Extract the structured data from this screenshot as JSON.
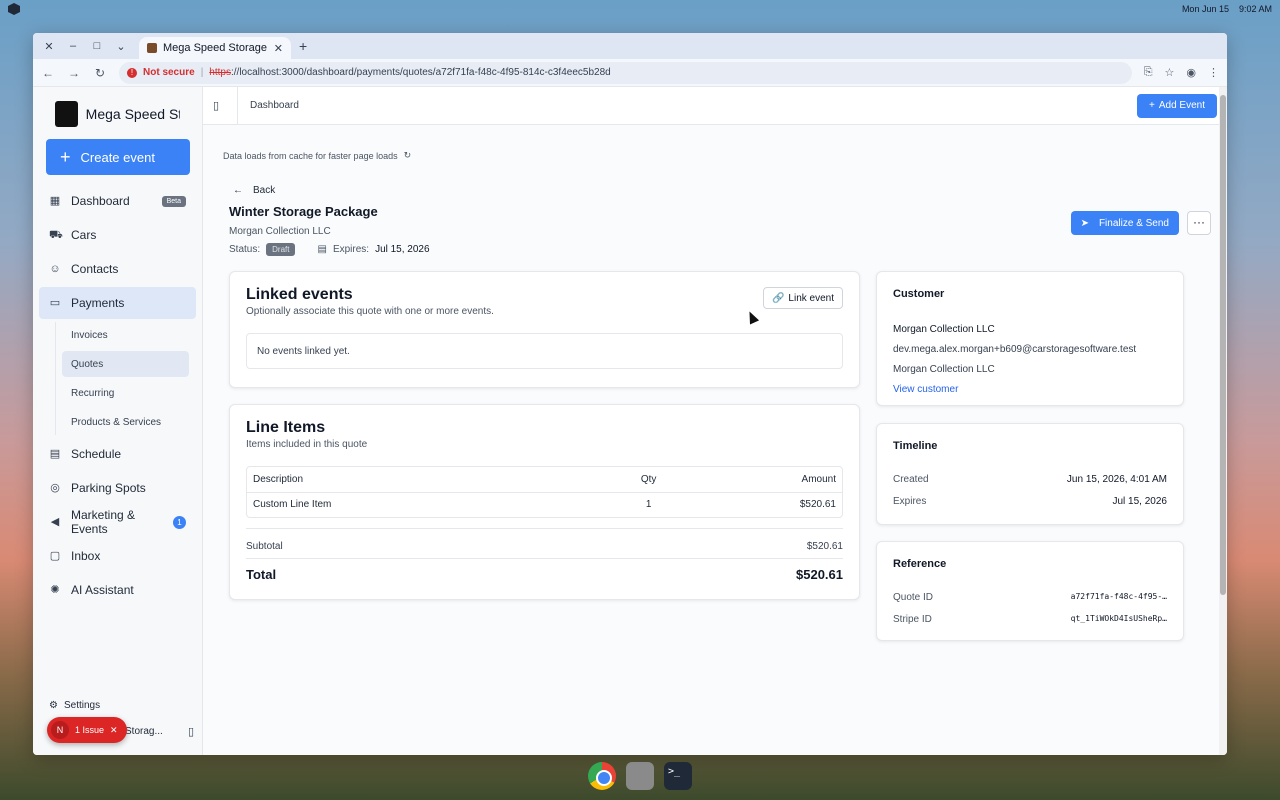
{
  "os": {
    "date": "Mon Jun 15",
    "time": "9:02 AM"
  },
  "browser": {
    "tab_title": "Mega Speed Storage",
    "not_secure": "Not secure",
    "url_scheme": "https",
    "url_rest": "://localhost:3000/dashboard/payments/quotes/a72f71fa-f48c-4f95-814c-c3f4eec5b28d"
  },
  "sidebar": {
    "brand": "Mega Speed St...",
    "create_event": "Create event",
    "items": [
      {
        "label": "Dashboard",
        "icon": "grid-icon",
        "badge": "Beta"
      },
      {
        "label": "Cars",
        "icon": "car-icon"
      },
      {
        "label": "Contacts",
        "icon": "users-icon"
      },
      {
        "label": "Payments",
        "icon": "credit-card-icon"
      },
      {
        "label": "Schedule",
        "icon": "calendar-icon"
      },
      {
        "label": "Parking Spots",
        "icon": "map-pin-icon"
      },
      {
        "label": "Marketing & Events",
        "icon": "megaphone-icon",
        "count": "1"
      },
      {
        "label": "Inbox",
        "icon": "message-icon"
      },
      {
        "label": "AI Assistant",
        "icon": "ai-icon"
      }
    ],
    "sub_items": [
      "Invoices",
      "Quotes",
      "Recurring",
      "Products & Services"
    ],
    "settings": "Settings",
    "workspace": "Storag...",
    "issue_avatar": "N",
    "issue": "1 Issue"
  },
  "header": {
    "breadcrumb": "Dashboard",
    "add_event": "Add Event"
  },
  "page": {
    "cache_note": "Data loads from cache for faster page loads",
    "back": "Back",
    "title": "Winter Storage Package",
    "company": "Morgan Collection LLC",
    "status_label": "Status:",
    "status": "Draft",
    "expires_label": "Expires:",
    "expires": "Jul 15, 2026",
    "finalize": "Finalize & Send",
    "more": "···"
  },
  "linked": {
    "title": "Linked events",
    "desc": "Optionally associate this quote with one or more events.",
    "link_btn": "Link event",
    "empty": "No events linked yet."
  },
  "line_items": {
    "title": "Line Items",
    "desc": "Items included in this quote",
    "headers": {
      "description": "Description",
      "qty": "Qty",
      "amount": "Amount"
    },
    "rows": [
      {
        "description": "Custom Line Item",
        "qty": "1",
        "amount": "$520.61"
      }
    ],
    "subtotal_label": "Subtotal",
    "subtotal": "$520.61",
    "total_label": "Total",
    "total": "$520.61"
  },
  "customer": {
    "title": "Customer",
    "name": "Morgan Collection LLC",
    "email": "dev.mega.alex.morgan+b609@carstoragesoftware.test",
    "company": "Morgan Collection LLC",
    "view": "View customer"
  },
  "timeline": {
    "title": "Timeline",
    "created_label": "Created",
    "created": "Jun 15, 2026, 4:01 AM",
    "expires_label": "Expires",
    "expires": "Jul 15, 2026"
  },
  "reference": {
    "title": "Reference",
    "quote_label": "Quote ID",
    "quote_id": "a72f71fa-f48c-4f95-…",
    "stripe_label": "Stripe ID",
    "stripe_id": "qt_1TiWOkD4IsUSheRp…"
  },
  "colors": {
    "accent": "#3b82f6",
    "issue": "#dc2626"
  }
}
